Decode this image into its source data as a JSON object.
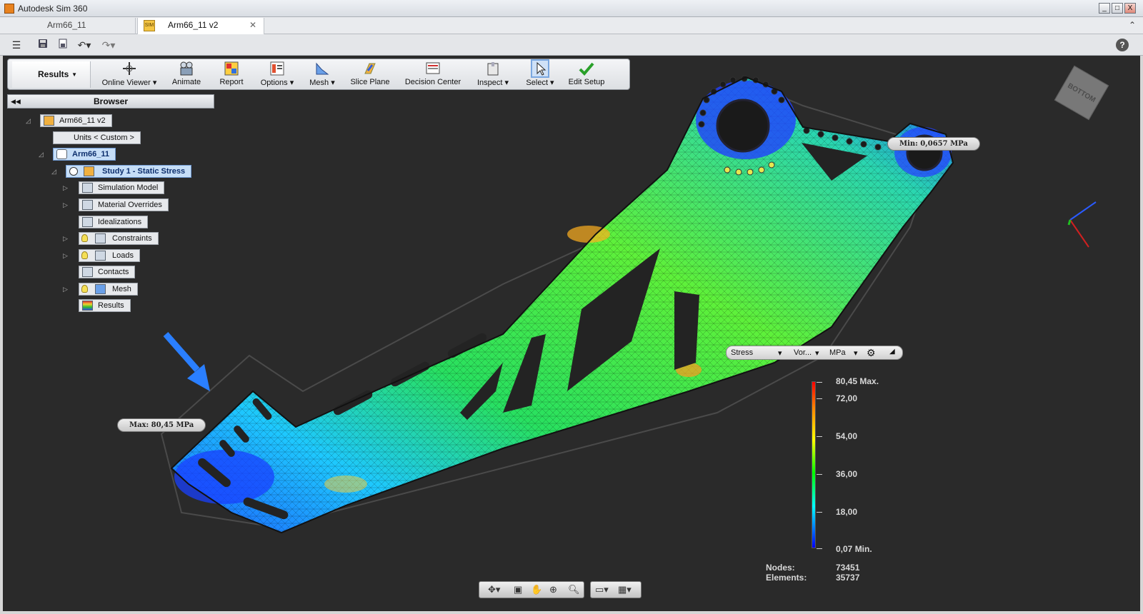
{
  "window": {
    "title": "Autodesk Sim 360",
    "controls": [
      "_",
      "□",
      "X"
    ]
  },
  "tabs": [
    {
      "label": "Arm66_11",
      "active": false
    },
    {
      "label": "Arm66_11 v2",
      "active": true,
      "badge": "SIM"
    }
  ],
  "quick_access": {
    "icons": [
      "menu-icon",
      "save-icon",
      "save-as-icon",
      "undo-icon",
      "redo-icon",
      "help-icon"
    ],
    "help_label": "?"
  },
  "ribbon": {
    "results_tab": "Results",
    "buttons": [
      {
        "label": "Online Viewer",
        "dropdown": true
      },
      {
        "label": "Animate",
        "dropdown": false
      },
      {
        "label": "Report",
        "dropdown": false
      },
      {
        "label": "Options",
        "dropdown": true
      },
      {
        "label": "Mesh",
        "dropdown": true
      },
      {
        "label": "Slice Plane",
        "dropdown": false
      },
      {
        "label": "Decision Center",
        "dropdown": false
      },
      {
        "label": "Inspect",
        "dropdown": true
      },
      {
        "label": "Select",
        "dropdown": true
      },
      {
        "label": "Edit Setup",
        "dropdown": false
      }
    ]
  },
  "browser": {
    "title": "Browser",
    "tree": [
      {
        "label": "Arm66_11 v2"
      },
      {
        "label": "Units < Custom >"
      },
      {
        "label": "Arm66_11"
      },
      {
        "label": "Study 1 - Static Stress"
      },
      {
        "label": "Simulation Model"
      },
      {
        "label": "Material Overrides"
      },
      {
        "label": "Idealizations"
      },
      {
        "label": "Constraints"
      },
      {
        "label": "Loads"
      },
      {
        "label": "Contacts"
      },
      {
        "label": "Mesh"
      },
      {
        "label": "Results"
      }
    ]
  },
  "probes": {
    "max": "Max: 80,45 MPa",
    "min": "Min: 0,0657 MPa"
  },
  "result_selector": {
    "type": "Stress",
    "component": "Vor...",
    "unit": "MPa"
  },
  "legend": {
    "labels": [
      "80,45 Max.",
      "72,00",
      "54,00",
      "36,00",
      "18,00",
      "0,07 Min."
    ],
    "colors": [
      "#ff0000",
      "#ffff00",
      "#00ff00",
      "#00ffff",
      "#0000ff"
    ]
  },
  "stats": {
    "nodes_label": "Nodes:",
    "nodes_value": "73451",
    "elements_label": "Elements:",
    "elements_value": "35737"
  },
  "viewcube": {
    "face": "BOTTOM"
  }
}
